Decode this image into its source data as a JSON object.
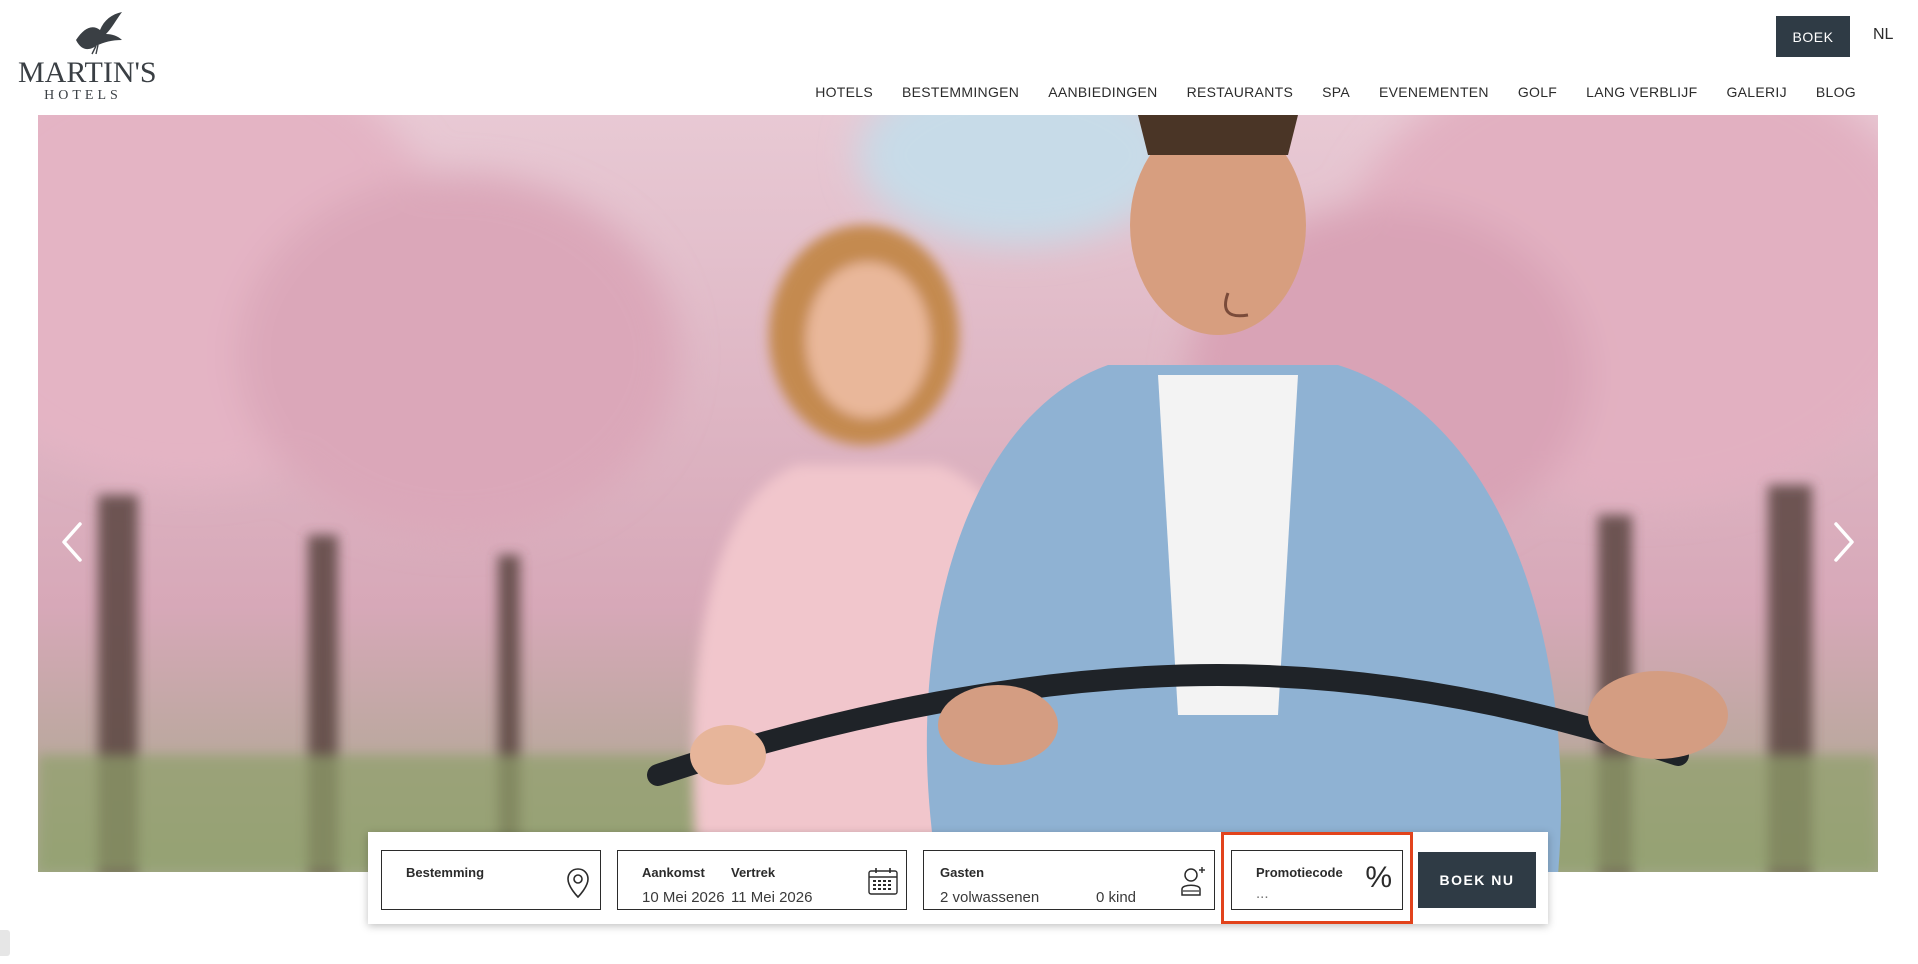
{
  "brand": {
    "name": "MARTIN'S",
    "sub": "HOTELS"
  },
  "header": {
    "book_label": "BOEK",
    "language": "NL"
  },
  "nav": {
    "items": [
      "HOTELS",
      "BESTEMMINGEN",
      "AANBIEDINGEN",
      "RESTAURANTS",
      "SPA",
      "EVENEMENTEN",
      "GOLF",
      "LANG VERBLIJF",
      "GALERIJ",
      "BLOG"
    ]
  },
  "booking": {
    "destination_label": "Bestemming",
    "arrival_label": "Aankomst",
    "arrival_value": "10 Mei 2026",
    "departure_label": "Vertrek",
    "departure_value": "11 Mei 2026",
    "guests_label": "Gasten",
    "adults_value": "2 volwassenen",
    "children_value": "0 kind",
    "promo_label": "Promotiecode",
    "promo_placeholder": "...",
    "promo_symbol": "%",
    "submit_label": "BOEK NU"
  },
  "colors": {
    "accent": "#2f3b45",
    "highlight": "#e2431c",
    "blossom": "#d9b5c2"
  }
}
